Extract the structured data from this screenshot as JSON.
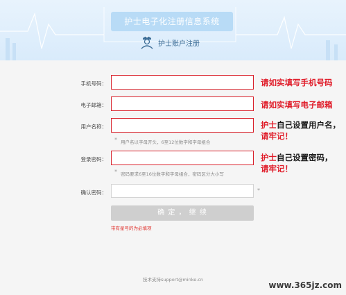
{
  "header": {
    "title": "护士电子化注册信息系统",
    "subtitle": "护士账户注册"
  },
  "form": {
    "phone_label": "手机号码：",
    "email_label": "电子邮箱：",
    "username_label": "用户名称：",
    "password_label": "登录密码：",
    "confirm_label": "确认密码：",
    "username_hint": "用户名以字母开头，6至12位数字和字母组合",
    "password_hint": "密码要求6至16位数字和字母组合，密码区分大小写",
    "required_mark": "*",
    "submit_label": "确 定 ， 继 续",
    "required_note": "带有星号的为必填项"
  },
  "annotations": {
    "phone_note": "请如实填写手机号码",
    "email_note": "请如实填写电子邮箱",
    "username_note_red": "护士",
    "username_note_black": "自己设置用户名，",
    "username_note_line2": "请牢记！",
    "password_note_red": "护士",
    "password_note_black": "自己设置密码，",
    "password_note_line2": "请牢记！"
  },
  "footer": {
    "tech_support": "技术支持support@minke.cn",
    "watermark": "www.365jz.com"
  },
  "colors": {
    "accent_red": "#d9212b",
    "header_bg": "#d9ebfb",
    "title_badge": "#b8dbf6",
    "button_disabled": "#cfcfcf"
  }
}
